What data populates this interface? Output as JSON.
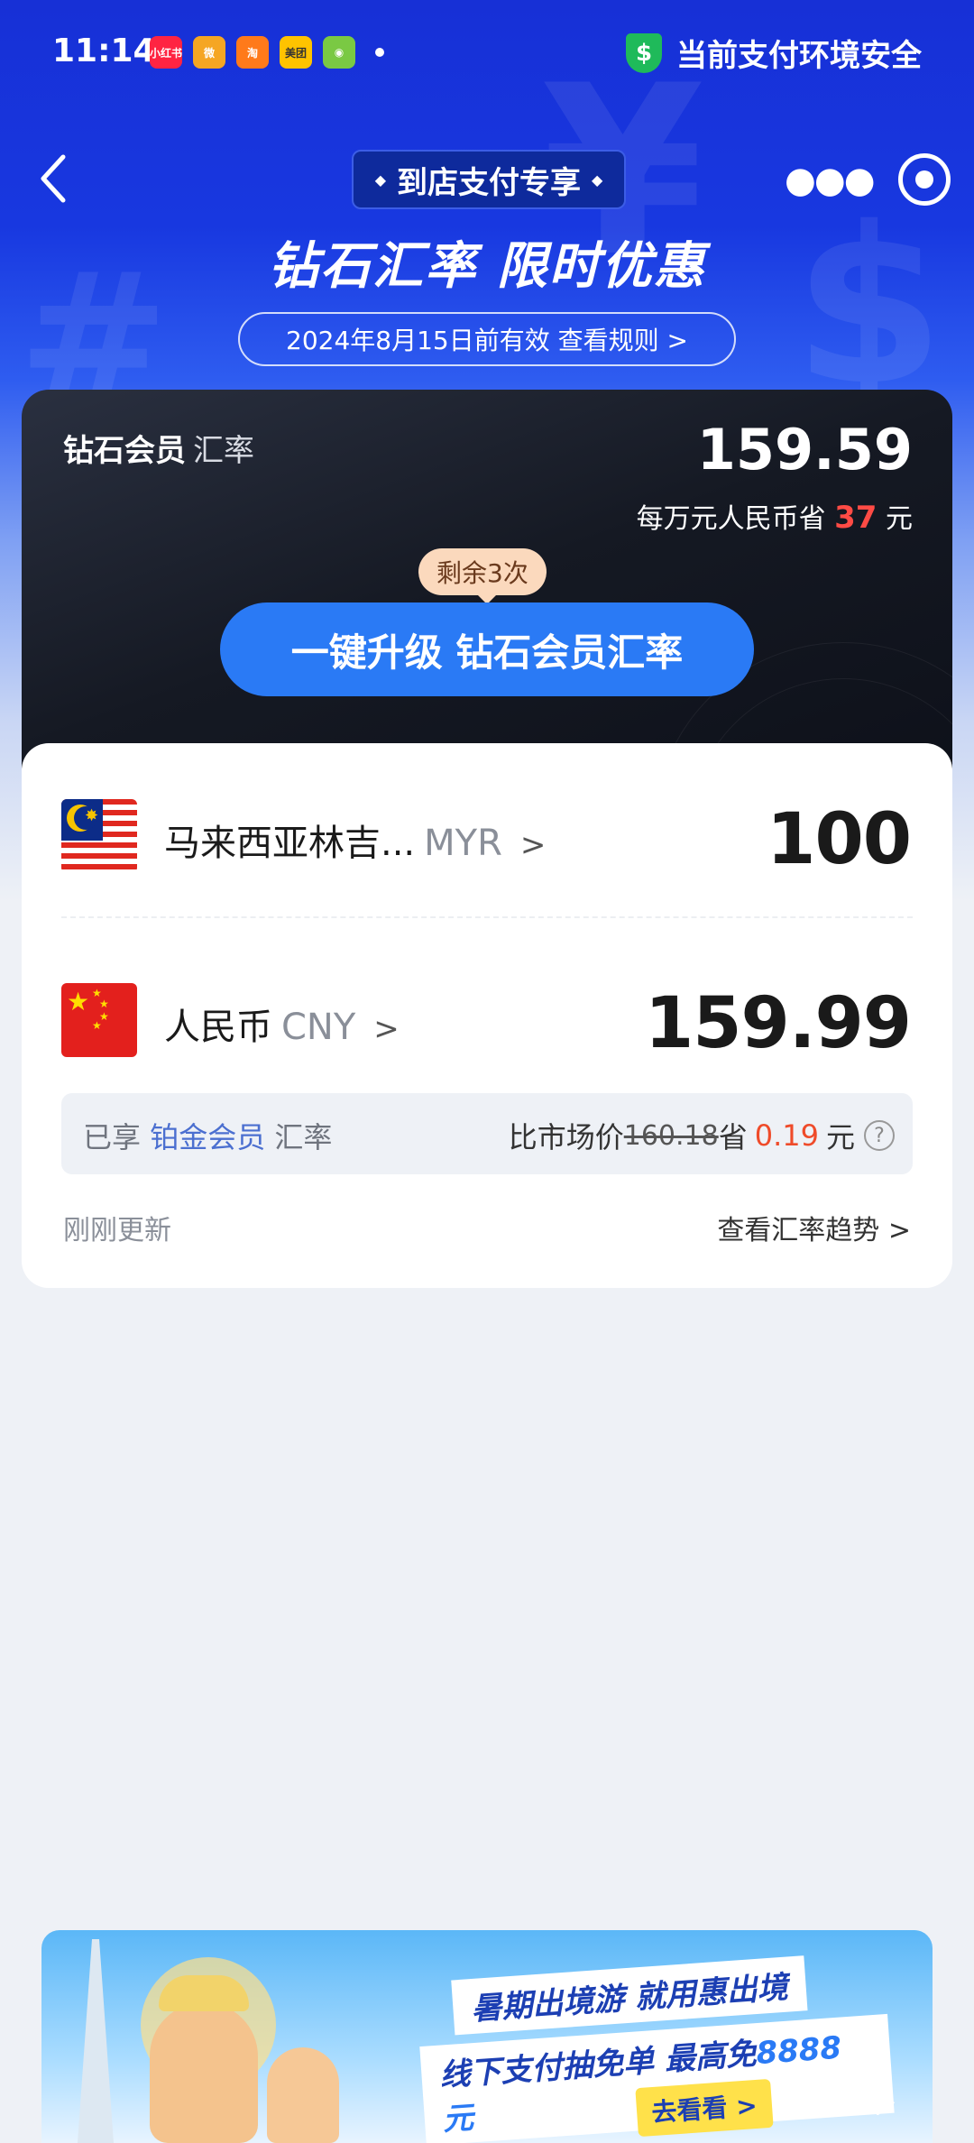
{
  "status_bar": {
    "time": "11:14",
    "apps": [
      {
        "name": "xiaohongshu",
        "label": "小红书",
        "color": "#ff2442"
      },
      {
        "name": "weibo",
        "label": "微",
        "color": "#f5a623"
      },
      {
        "name": "taobao-app",
        "label": "淘",
        "color": "#ff7a1a"
      },
      {
        "name": "meituan",
        "label": "美团",
        "color": "#ffc300"
      },
      {
        "name": "app5",
        "label": "◉",
        "color": "#7ac943"
      }
    ],
    "security_text": "当前支付环境安全"
  },
  "nav": {
    "pill_label": "到店支付专享",
    "diamond_glyph": "◆"
  },
  "hero": {
    "headline": "钻石汇率 限时优惠",
    "validity": "2024年8月15日前有效 查看规则 >"
  },
  "diamond_card": {
    "title": "钻石会员",
    "subtitle": "汇率",
    "rate": "159.59",
    "save_prefix": "每万元人民币省",
    "save_amount": "37",
    "save_suffix": "元",
    "remaining": "剩余3次",
    "upgrade_button": "一键升级 钻石会员汇率"
  },
  "converter": {
    "from": {
      "name": "马来西亚林吉...",
      "code": "MYR",
      "amount": "100"
    },
    "to": {
      "name": "人民币",
      "code": "CNY",
      "amount": "159.99"
    },
    "chevron": ">",
    "member": {
      "prefix": "已享",
      "tier": "铂金会员",
      "suffix": "汇率",
      "compare_label": "比市场价",
      "market_price": "160.18",
      "save_label": "省",
      "save_amount": "0.19",
      "unit": "元",
      "help": "?"
    },
    "updated": "刚刚更新",
    "trend_link": "查看汇率趋势 >"
  },
  "banner": {
    "line1": "暑期出境游 就用惠出境",
    "line2_prefix": "线下支付抽免单 最高免",
    "line2_highlight": "8888元",
    "cta": "去看看 >"
  },
  "colors": {
    "hero_blue": "#1730d6",
    "upgrade_blue": "#2a7af5",
    "save_red": "#ff4b45",
    "secure_green": "#1fba5a"
  }
}
